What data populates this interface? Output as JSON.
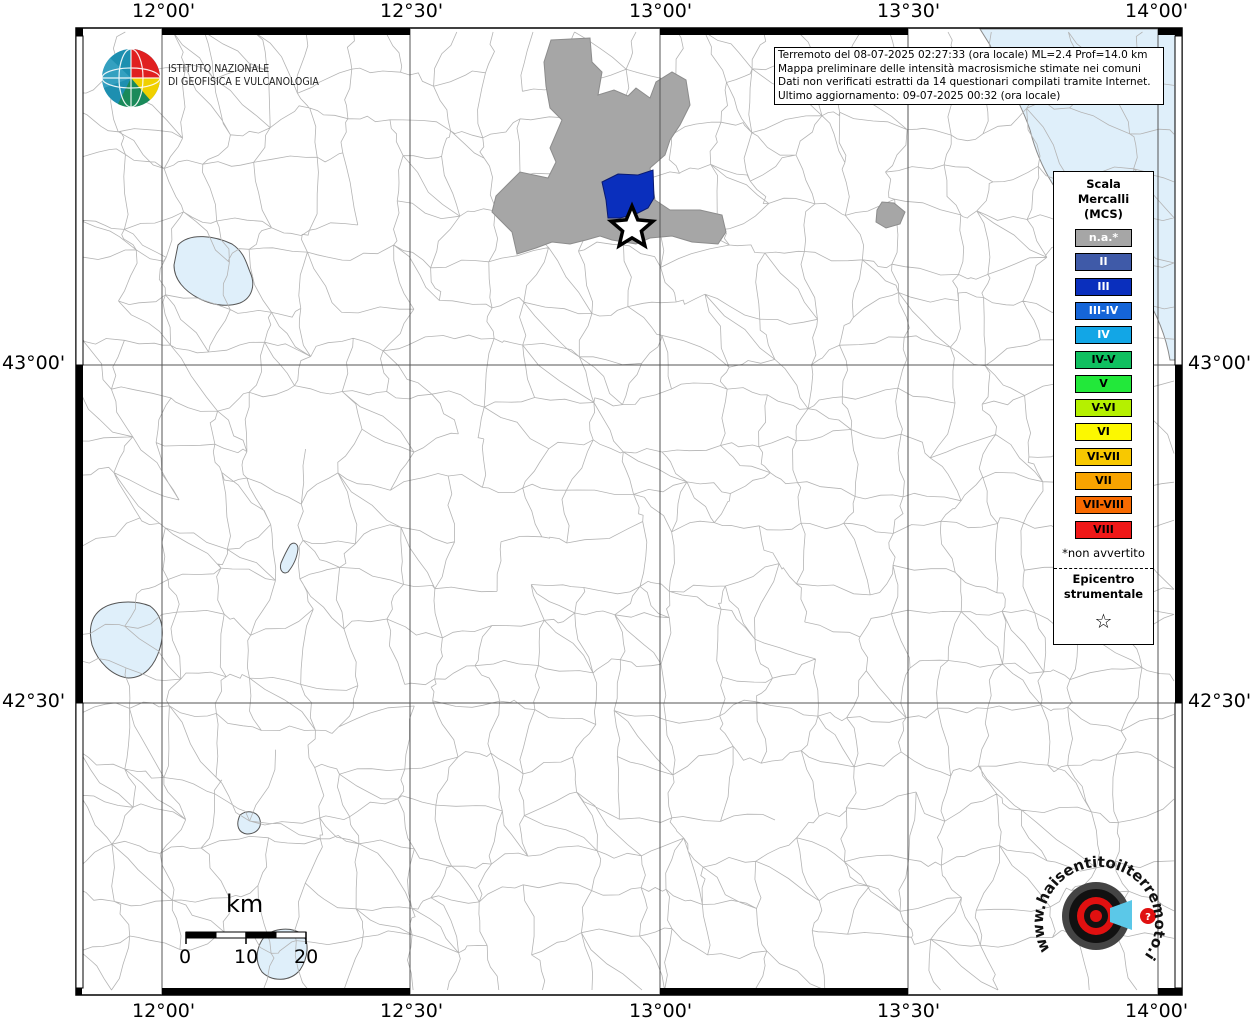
{
  "axes": {
    "lon_labels": [
      "12°00'",
      "12°30'",
      "13°00'",
      "13°30'",
      "14°00'"
    ],
    "lat_labels": [
      "43°00'",
      "42°30'"
    ]
  },
  "logo": {
    "line1": "ISTITUTO NAZIONALE",
    "line2": "DI GEOFISICA E VULCANOLOGIA"
  },
  "info": {
    "line1": "Terremoto del 08-07-2025 02:27:33 (ora locale) ML=2.4 Prof=14.0 km",
    "line2": "Mappa preliminare delle intensità macrosismiche stimate nei comuni",
    "line3": "Dati non verificati estratti da 14 questionari compilati tramite Internet.",
    "line4": "Ultimo aggiornamento: 09-07-2025 00:32 (ora locale)"
  },
  "legend": {
    "title1": "Scala",
    "title2": "Mercalli",
    "title3": "(MCS)",
    "items": [
      {
        "label": "n.a.*",
        "color": "#a6a6a6",
        "text_color": "#ffffff"
      },
      {
        "label": "II",
        "color": "#3f5aa8",
        "text_color": "#ffffff"
      },
      {
        "label": "III",
        "color": "#0a2fbd",
        "text_color": "#ffffff"
      },
      {
        "label": "III-IV",
        "color": "#1565d8",
        "text_color": "#ffffff"
      },
      {
        "label": "IV",
        "color": "#12a6e6",
        "text_color": "#ffffff"
      },
      {
        "label": "IV-V",
        "color": "#10c060",
        "text_color": "#000000"
      },
      {
        "label": "V",
        "color": "#22e83a",
        "text_color": "#000000"
      },
      {
        "label": "V-VI",
        "color": "#b5f000",
        "text_color": "#000000"
      },
      {
        "label": "VI",
        "color": "#fcf800",
        "text_color": "#000000"
      },
      {
        "label": "VI-VII",
        "color": "#f8c800",
        "text_color": "#000000"
      },
      {
        "label": "VII",
        "color": "#f8a400",
        "text_color": "#000000"
      },
      {
        "label": "VII-VIII",
        "color": "#f86a00",
        "text_color": "#000000"
      },
      {
        "label": "VIII",
        "color": "#f01818",
        "text_color": "#000000"
      }
    ],
    "note": "*non avvertito",
    "epi1": "Epicentro",
    "epi2": "strumentale",
    "star": "☆"
  },
  "scale": {
    "unit": "km",
    "ticks": [
      "0",
      "10",
      "20"
    ]
  },
  "watermark": {
    "text": "www.haisentitoilterremoto.it"
  },
  "colors": {
    "water": "#dfeffa",
    "felt_na": "#a6a6a6",
    "felt_iii": "#0a2fbd",
    "boundary": "#b4b4b4"
  }
}
